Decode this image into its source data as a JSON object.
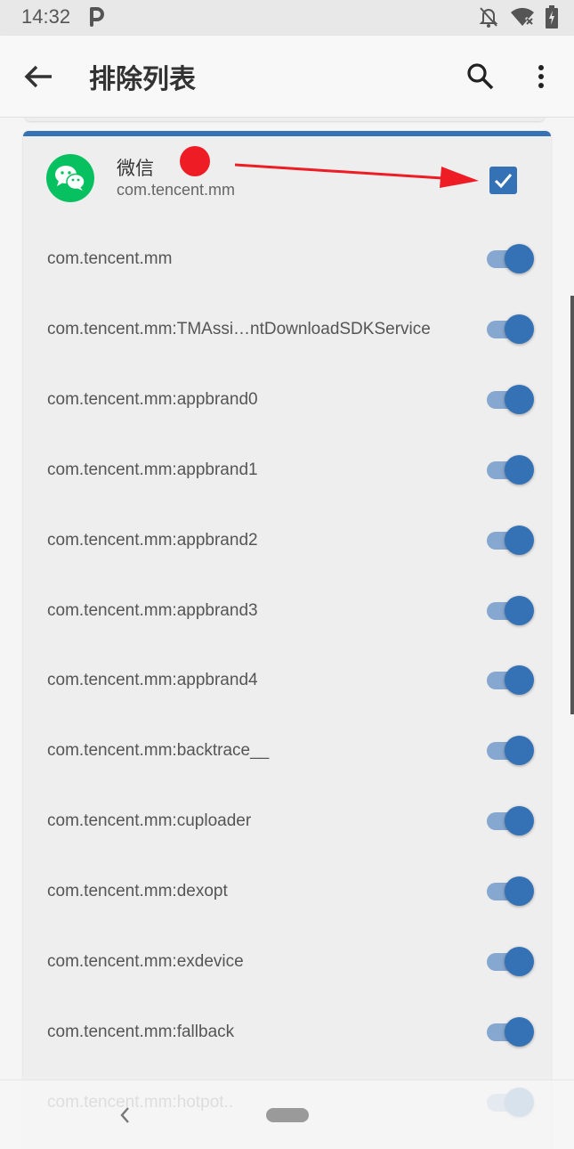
{
  "status_bar": {
    "time": "14:32",
    "icons": [
      "parking-icon",
      "notifications-off-icon",
      "wifi-off-icon",
      "battery-charging-icon"
    ]
  },
  "app_bar": {
    "title": "排除列表",
    "back_icon": "arrow-back-icon",
    "search_icon": "search-icon",
    "more_icon": "more-vert-icon"
  },
  "app_card": {
    "name": "微信",
    "package": "com.tencent.mm",
    "checked": true,
    "accent_color": "#3471b5",
    "processes": [
      {
        "label": "com.tencent.mm",
        "enabled": true
      },
      {
        "label": "com.tencent.mm:TMAssi…ntDownloadSDKService",
        "enabled": true
      },
      {
        "label": "com.tencent.mm:appbrand0",
        "enabled": true
      },
      {
        "label": "com.tencent.mm:appbrand1",
        "enabled": true
      },
      {
        "label": "com.tencent.mm:appbrand2",
        "enabled": true
      },
      {
        "label": "com.tencent.mm:appbrand3",
        "enabled": true
      },
      {
        "label": "com.tencent.mm:appbrand4",
        "enabled": true
      },
      {
        "label": "com.tencent.mm:backtrace__",
        "enabled": true
      },
      {
        "label": "com.tencent.mm:cuploader",
        "enabled": true
      },
      {
        "label": "com.tencent.mm:dexopt",
        "enabled": true
      },
      {
        "label": "com.tencent.mm:exdevice",
        "enabled": true
      },
      {
        "label": "com.tencent.mm:fallback",
        "enabled": true
      },
      {
        "label": "com.tencent.mm:hotpot..",
        "enabled": true
      }
    ]
  },
  "annotation": {
    "marker_color": "#ee1c25"
  },
  "nav_bar": {
    "back_icon": "nav-back-icon",
    "home_icon": "home-pill-icon"
  }
}
